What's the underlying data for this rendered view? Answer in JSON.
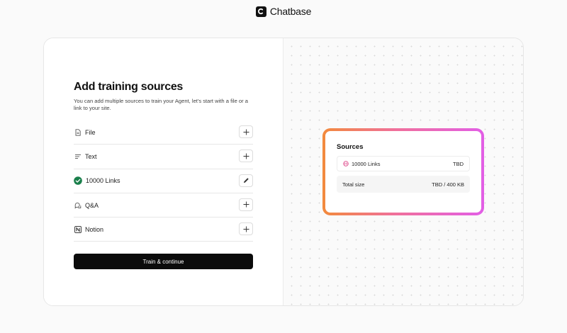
{
  "brand": {
    "name": "Chatbase",
    "logo_icon": "chatbase-logo-icon"
  },
  "main": {
    "heading": "Add training sources",
    "subtext": "You can add multiple sources to train your Agent, let's start with a file or a link to your site.",
    "sources": [
      {
        "label": "File",
        "icon": "file-icon",
        "action": "add",
        "action_icon": "plus-icon"
      },
      {
        "label": "Text",
        "icon": "text-lines-icon",
        "action": "add",
        "action_icon": "plus-icon"
      },
      {
        "label": "10000 Links",
        "icon": "check-circle-icon",
        "action": "edit",
        "action_icon": "pencil-icon"
      },
      {
        "label": "Q&A",
        "icon": "qa-chat-icon",
        "action": "add",
        "action_icon": "plus-icon"
      },
      {
        "label": "Notion",
        "icon": "notion-icon",
        "action": "add",
        "action_icon": "plus-icon"
      }
    ],
    "train_button": "Train & continue"
  },
  "summary": {
    "title": "Sources",
    "items": [
      {
        "icon": "globe-icon",
        "label": "10000 Links",
        "value": "TBD"
      }
    ],
    "total_label": "Total size",
    "total_value": "TBD / 400 KB"
  },
  "colors": {
    "accent_check": "#1a7f4b",
    "gradient_start": "#f28a3c",
    "gradient_mid": "#f0709b",
    "gradient_end": "#e25ee6",
    "button_bg": "#0b0b0b"
  }
}
